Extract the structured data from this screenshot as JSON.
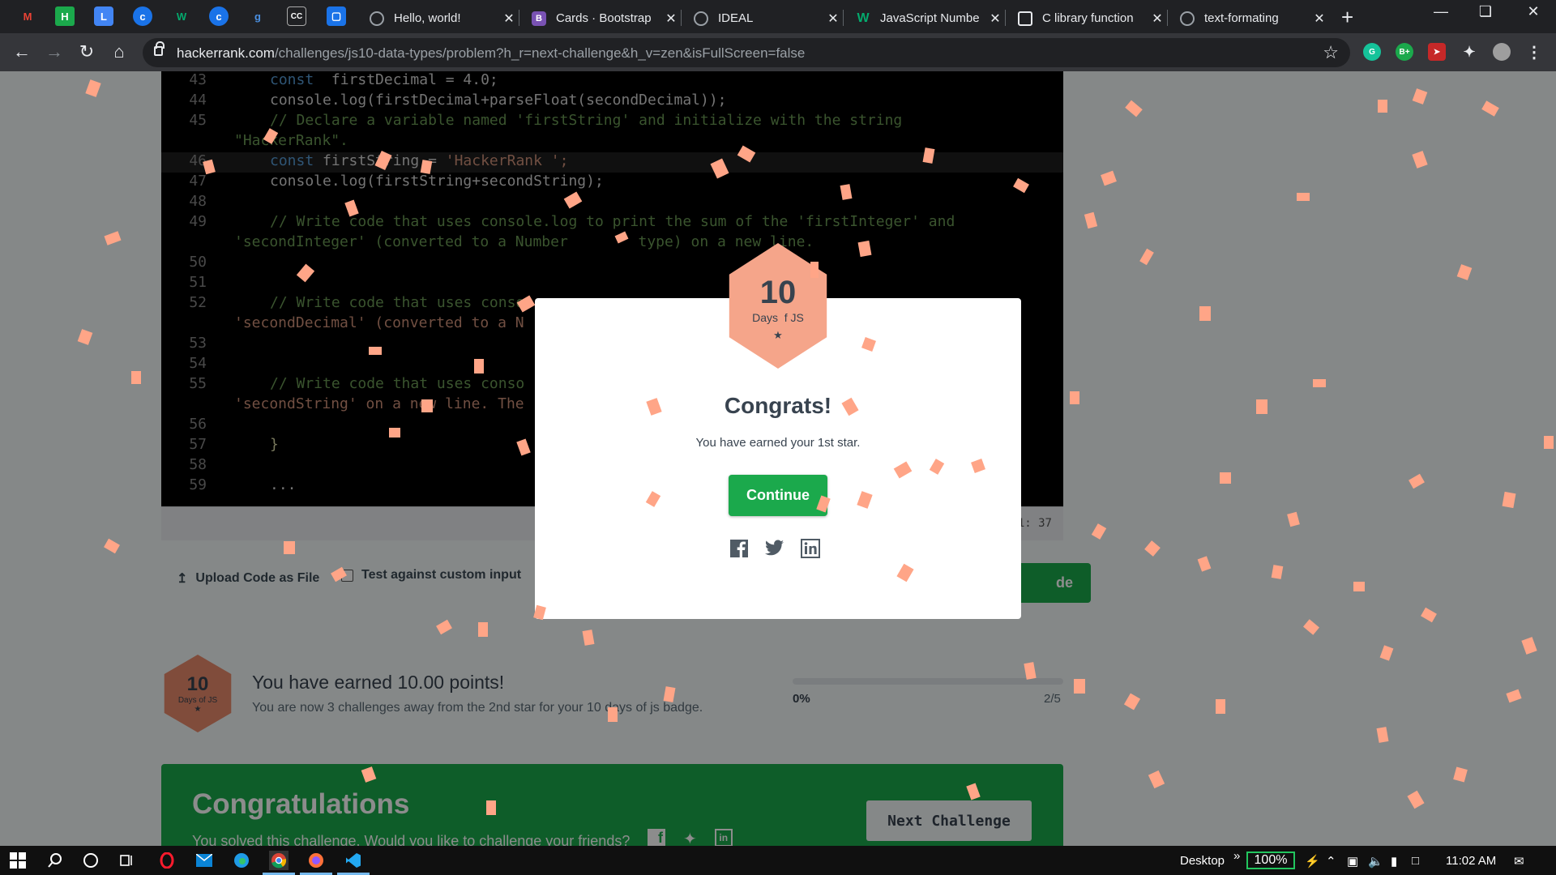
{
  "browser": {
    "tabs": [
      {
        "title": "Hello, world!",
        "favicon": "globe-icon"
      },
      {
        "title": "Cards · Bootstrap",
        "favicon": "bootstrap-icon"
      },
      {
        "title": "IDEAL",
        "favicon": "globe-icon"
      },
      {
        "title": "JavaScript Numbe",
        "favicon": "w3schools-icon"
      },
      {
        "title": "C library function",
        "favicon": "tutorialspoint-icon"
      },
      {
        "title": "text-formating",
        "favicon": "globe-icon"
      }
    ],
    "url_host": "hackerrank.com",
    "url_path": "/challenges/js10-data-types/problem?h_r=next-challenge&h_v=zen&isFullScreen=false",
    "extensions": [
      "grammarly-icon",
      "b-plus-icon",
      "rocket-icon",
      "puzzle-icon",
      "profile-icon"
    ]
  },
  "editor": {
    "lines": [
      {
        "n": "43",
        "parts": [
          [
            "kw",
            "const"
          ],
          [
            "",
            "  firstDecimal = 4.0;"
          ]
        ]
      },
      {
        "n": "44",
        "parts": [
          [
            "",
            "console.log(firstDecimal+parseFloat(secondDecimal));"
          ]
        ]
      },
      {
        "n": "45",
        "parts": [
          [
            "cm",
            "// Declare a variable named 'firstString' and initialize with the string"
          ]
        ]
      },
      {
        "n": "",
        "parts": [
          [
            "cm",
            "\"HackerRank\"."
          ]
        ],
        "wrap": true
      },
      {
        "n": "46",
        "parts": [
          [
            "kw",
            "const"
          ],
          [
            "",
            " firstString = "
          ],
          [
            "str",
            "'HackerRank ';"
          ]
        ]
      },
      {
        "n": "47",
        "parts": [
          [
            "",
            "console.log(firstString+secondString);"
          ]
        ]
      },
      {
        "n": "48",
        "parts": [
          [
            "",
            ""
          ]
        ]
      },
      {
        "n": "49",
        "parts": [
          [
            "cm",
            "// Write code that uses console.log to print the sum of the 'firstInteger' and"
          ]
        ]
      },
      {
        "n": "",
        "parts": [
          [
            "cm",
            "'secondInteger' (converted to a Number        type) on a new line."
          ]
        ],
        "wrap": true
      },
      {
        "n": "50",
        "parts": [
          [
            "",
            ""
          ]
        ]
      },
      {
        "n": "51",
        "parts": [
          [
            "",
            ""
          ]
        ]
      },
      {
        "n": "52",
        "parts": [
          [
            "cm",
            "// Write code that uses conso"
          ]
        ]
      },
      {
        "n": "",
        "parts": [
          [
            "str",
            "'secondDecimal' (converted to a N"
          ]
        ],
        "wrap": true
      },
      {
        "n": "53",
        "parts": [
          [
            "",
            ""
          ]
        ]
      },
      {
        "n": "54",
        "parts": [
          [
            "",
            ""
          ]
        ]
      },
      {
        "n": "55",
        "parts": [
          [
            "cm",
            "// Write code that uses conso"
          ]
        ]
      },
      {
        "n": "",
        "parts": [
          [
            "str",
            "'secondString' on a new line. The"
          ]
        ],
        "wrap": true
      },
      {
        "n": "56",
        "parts": [
          [
            "",
            ""
          ]
        ]
      },
      {
        "n": "57",
        "parts": [
          [
            "fn",
            "}"
          ]
        ]
      },
      {
        "n": "58",
        "parts": [
          [
            "",
            ""
          ]
        ]
      },
      {
        "n": "59",
        "parts": [
          [
            "",
            "..."
          ]
        ]
      }
    ],
    "status": "1: 37"
  },
  "actions": {
    "upload": "Upload Code as File",
    "custom_input": "Test against custom input",
    "submit": "de"
  },
  "badge": {
    "count": "10",
    "name": "Days of JS",
    "modal_name": "Days  f JS"
  },
  "points": {
    "title": "You have earned 10.00 points!",
    "subtitle": "You are now 3 challenges away from the 2nd star for your 10 days of js badge.",
    "progress_label": "0%",
    "progress_value": 0,
    "progress_total": "2/5"
  },
  "congrats_bar": {
    "title": "Congratulations",
    "subtitle": "You solved this challenge. Would you like to challenge your friends?",
    "next": "Next Challenge"
  },
  "modal": {
    "title": "Congrats!",
    "subtitle": "You have earned your 1st star.",
    "continue": "Continue",
    "share_icons": [
      "facebook-icon",
      "twitter-icon",
      "linkedin-icon"
    ]
  },
  "taskbar": {
    "desktop": "Desktop",
    "battery": "100%",
    "time": "11:02 AM"
  },
  "colors": {
    "accent_green": "#1ba94c",
    "badge_salmon": "#f5a58a",
    "confetti": "#ffa587"
  }
}
